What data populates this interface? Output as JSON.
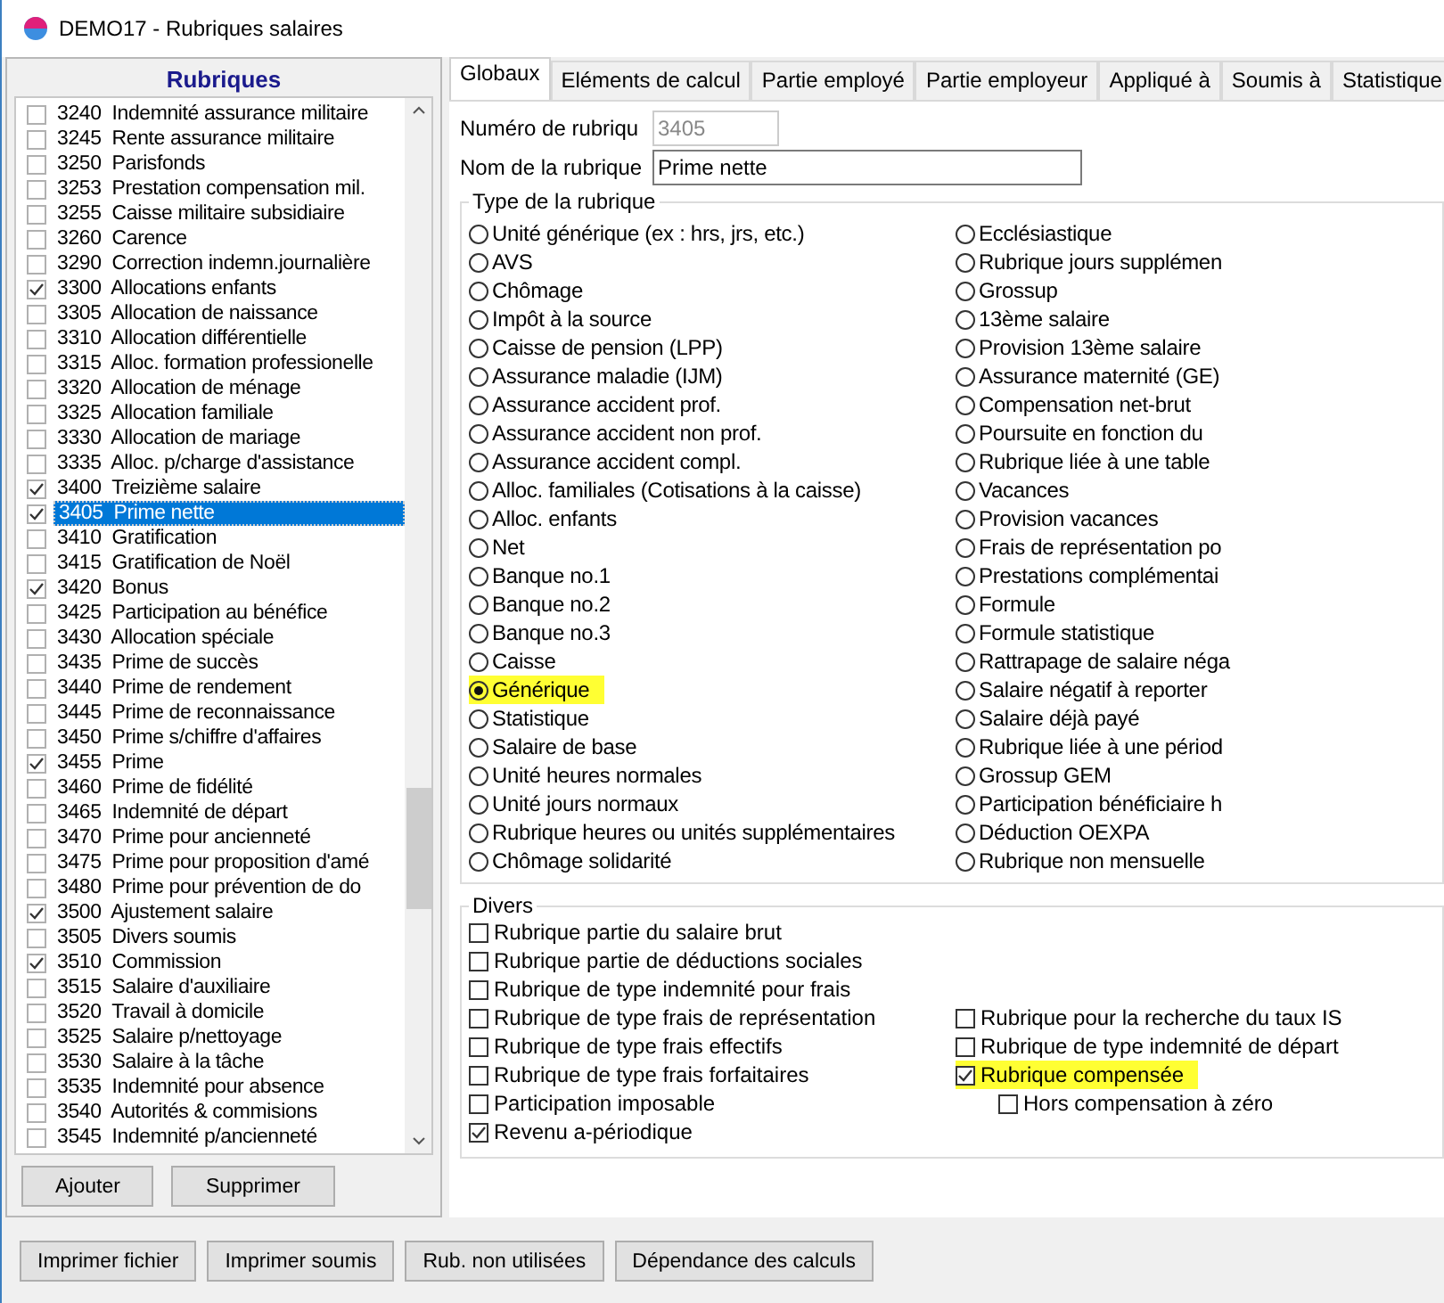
{
  "window": {
    "title": "DEMO17 - Rubriques salaires"
  },
  "sidebar": {
    "title": "Rubriques",
    "items": [
      {
        "code": "3240",
        "name": "Indemnité assurance militaire",
        "checked": false,
        "selected": false
      },
      {
        "code": "3245",
        "name": "Rente assurance militaire",
        "checked": false,
        "selected": false
      },
      {
        "code": "3250",
        "name": "Parisfonds",
        "checked": false,
        "selected": false
      },
      {
        "code": "3253",
        "name": "Prestation compensation mil.",
        "checked": false,
        "selected": false
      },
      {
        "code": "3255",
        "name": "Caisse militaire subsidiaire",
        "checked": false,
        "selected": false
      },
      {
        "code": "3260",
        "name": "Carence",
        "checked": false,
        "selected": false
      },
      {
        "code": "3290",
        "name": "Correction indemn.journalière",
        "checked": false,
        "selected": false
      },
      {
        "code": "3300",
        "name": "Allocations enfants",
        "checked": true,
        "selected": false
      },
      {
        "code": "3305",
        "name": "Allocation de naissance",
        "checked": false,
        "selected": false
      },
      {
        "code": "3310",
        "name": "Allocation différentielle",
        "checked": false,
        "selected": false
      },
      {
        "code": "3315",
        "name": "Alloc. formation professionelle",
        "checked": false,
        "selected": false
      },
      {
        "code": "3320",
        "name": "Allocation de ménage",
        "checked": false,
        "selected": false
      },
      {
        "code": "3325",
        "name": "Allocation familiale",
        "checked": false,
        "selected": false
      },
      {
        "code": "3330",
        "name": "Allocation de mariage",
        "checked": false,
        "selected": false
      },
      {
        "code": "3335",
        "name": "Alloc. p/charge d'assistance",
        "checked": false,
        "selected": false
      },
      {
        "code": "3400",
        "name": "Treizième salaire",
        "checked": true,
        "selected": false
      },
      {
        "code": "3405",
        "name": "Prime nette",
        "checked": true,
        "selected": true
      },
      {
        "code": "3410",
        "name": "Gratification",
        "checked": false,
        "selected": false
      },
      {
        "code": "3415",
        "name": "Gratification de Noël",
        "checked": false,
        "selected": false
      },
      {
        "code": "3420",
        "name": "Bonus",
        "checked": true,
        "selected": false
      },
      {
        "code": "3425",
        "name": "Participation au bénéfice",
        "checked": false,
        "selected": false
      },
      {
        "code": "3430",
        "name": "Allocation spéciale",
        "checked": false,
        "selected": false
      },
      {
        "code": "3435",
        "name": "Prime de succès",
        "checked": false,
        "selected": false
      },
      {
        "code": "3440",
        "name": "Prime de rendement",
        "checked": false,
        "selected": false
      },
      {
        "code": "3445",
        "name": "Prime de reconnaissance",
        "checked": false,
        "selected": false
      },
      {
        "code": "3450",
        "name": "Prime s/chiffre d'affaires",
        "checked": false,
        "selected": false
      },
      {
        "code": "3455",
        "name": "Prime",
        "checked": true,
        "selected": false
      },
      {
        "code": "3460",
        "name": "Prime de fidélité",
        "checked": false,
        "selected": false
      },
      {
        "code": "3465",
        "name": "Indemnité de départ",
        "checked": false,
        "selected": false
      },
      {
        "code": "3470",
        "name": "Prime pour ancienneté",
        "checked": false,
        "selected": false
      },
      {
        "code": "3475",
        "name": "Prime pour proposition d'amé",
        "checked": false,
        "selected": false
      },
      {
        "code": "3480",
        "name": "Prime pour prévention de do",
        "checked": false,
        "selected": false
      },
      {
        "code": "3500",
        "name": "Ajustement salaire",
        "checked": true,
        "selected": false
      },
      {
        "code": "3505",
        "name": "Divers soumis",
        "checked": false,
        "selected": false
      },
      {
        "code": "3510",
        "name": "Commission",
        "checked": true,
        "selected": false
      },
      {
        "code": "3515",
        "name": "Salaire d'auxiliaire",
        "checked": false,
        "selected": false
      },
      {
        "code": "3520",
        "name": "Travail à domicile",
        "checked": false,
        "selected": false
      },
      {
        "code": "3525",
        "name": "Salaire p/nettoyage",
        "checked": false,
        "selected": false
      },
      {
        "code": "3530",
        "name": "Salaire à la tâche",
        "checked": false,
        "selected": false
      },
      {
        "code": "3535",
        "name": "Indemnité pour absence",
        "checked": false,
        "selected": false
      },
      {
        "code": "3540",
        "name": "Autorités & commisions",
        "checked": false,
        "selected": false
      },
      {
        "code": "3545",
        "name": "Indemnité p/ancienneté",
        "checked": false,
        "selected": false
      }
    ],
    "buttons": [
      "Ajouter",
      "Supprimer"
    ]
  },
  "tabs": [
    {
      "label": "Globaux",
      "selected": true
    },
    {
      "label": "Eléments de calcul",
      "selected": false
    },
    {
      "label": "Partie employé",
      "selected": false
    },
    {
      "label": "Partie employeur",
      "selected": false
    },
    {
      "label": "Appliqué à",
      "selected": false
    },
    {
      "label": "Soumis à",
      "selected": false
    },
    {
      "label": "Statistique",
      "selected": false
    }
  ],
  "fields": [
    {
      "label": "Numéro de rubriqu",
      "value": "3405",
      "disabled": true
    },
    {
      "label": "Nom de la rubrique",
      "value": "Prime nette",
      "disabled": false
    }
  ],
  "type_group": {
    "title": "Type de la rubrique",
    "columns": [
      [
        {
          "label": "Unité générique (ex : hrs, jrs, etc.)",
          "selected": false,
          "highlighted": false
        },
        {
          "label": "AVS",
          "selected": false,
          "highlighted": false
        },
        {
          "label": "Chômage",
          "selected": false,
          "highlighted": false
        },
        {
          "label": "Impôt à la source",
          "selected": false,
          "highlighted": false
        },
        {
          "label": "Caisse de pension (LPP)",
          "selected": false,
          "highlighted": false
        },
        {
          "label": "Assurance maladie (IJM)",
          "selected": false,
          "highlighted": false
        },
        {
          "label": "Assurance accident prof.",
          "selected": false,
          "highlighted": false
        },
        {
          "label": "Assurance accident non prof.",
          "selected": false,
          "highlighted": false
        },
        {
          "label": "Assurance accident compl.",
          "selected": false,
          "highlighted": false
        },
        {
          "label": "Alloc. familiales (Cotisations à la caisse)",
          "selected": false,
          "highlighted": false
        },
        {
          "label": "Alloc. enfants",
          "selected": false,
          "highlighted": false
        },
        {
          "label": "Net",
          "selected": false,
          "highlighted": false
        },
        {
          "label": "Banque no.1",
          "selected": false,
          "highlighted": false
        },
        {
          "label": "Banque no.2",
          "selected": false,
          "highlighted": false
        },
        {
          "label": "Banque no.3",
          "selected": false,
          "highlighted": false
        },
        {
          "label": "Caisse",
          "selected": false,
          "highlighted": false
        },
        {
          "label": "Générique",
          "selected": true,
          "highlighted": true
        },
        {
          "label": "Statistique",
          "selected": false,
          "highlighted": false
        },
        {
          "label": "Salaire de base",
          "selected": false,
          "highlighted": false
        },
        {
          "label": "Unité heures normales",
          "selected": false,
          "highlighted": false
        },
        {
          "label": "Unité jours normaux",
          "selected": false,
          "highlighted": false
        },
        {
          "label": "Rubrique heures ou unités supplémentaires",
          "selected": false,
          "highlighted": false
        },
        {
          "label": "Chômage solidarité",
          "selected": false,
          "highlighted": false
        }
      ],
      [
        {
          "label": "Ecclésiastique",
          "selected": false,
          "highlighted": false
        },
        {
          "label": "Rubrique jours supplémen",
          "selected": false,
          "highlighted": false
        },
        {
          "label": "Grossup",
          "selected": false,
          "highlighted": false
        },
        {
          "label": "13ème salaire",
          "selected": false,
          "highlighted": false
        },
        {
          "label": "Provision 13ème salaire",
          "selected": false,
          "highlighted": false
        },
        {
          "label": "Assurance maternité (GE)",
          "selected": false,
          "highlighted": false
        },
        {
          "label": "Compensation net-brut",
          "selected": false,
          "highlighted": false
        },
        {
          "label": "Poursuite en fonction du",
          "selected": false,
          "highlighted": false
        },
        {
          "label": "Rubrique liée à une table",
          "selected": false,
          "highlighted": false
        },
        {
          "label": "Vacances",
          "selected": false,
          "highlighted": false
        },
        {
          "label": "Provision vacances",
          "selected": false,
          "highlighted": false
        },
        {
          "label": "Frais de représentation po",
          "selected": false,
          "highlighted": false
        },
        {
          "label": "Prestations complémentai",
          "selected": false,
          "highlighted": false
        },
        {
          "label": "Formule",
          "selected": false,
          "highlighted": false
        },
        {
          "label": "Formule statistique",
          "selected": false,
          "highlighted": false
        },
        {
          "label": "Rattrapage de salaire néga",
          "selected": false,
          "highlighted": false
        },
        {
          "label": "Salaire négatif à reporter",
          "selected": false,
          "highlighted": false
        },
        {
          "label": "Salaire déjà payé",
          "selected": false,
          "highlighted": false
        },
        {
          "label": "Rubrique liée à une périod",
          "selected": false,
          "highlighted": false
        },
        {
          "label": "Grossup GEM",
          "selected": false,
          "highlighted": false
        },
        {
          "label": "Participation bénéficiaire h",
          "selected": false,
          "highlighted": false
        },
        {
          "label": "Déduction OEXPA",
          "selected": false,
          "highlighted": false
        },
        {
          "label": "Rubrique non mensuelle",
          "selected": false,
          "highlighted": false
        }
      ]
    ]
  },
  "divers": {
    "title": "Divers",
    "columns": [
      [
        {
          "label": "Rubrique partie du salaire brut",
          "checked": false,
          "highlighted": false
        },
        {
          "label": "Rubrique partie de déductions sociales",
          "checked": false,
          "highlighted": false
        },
        {
          "label": "Rubrique de type indemnité pour frais",
          "checked": false,
          "highlighted": false
        },
        {
          "label": "Rubrique de type frais de représentation",
          "checked": false,
          "highlighted": false
        },
        {
          "label": "Rubrique de type frais effectifs",
          "checked": false,
          "highlighted": false
        },
        {
          "label": "Rubrique de type frais forfaitaires",
          "checked": false,
          "highlighted": false
        },
        {
          "label": "Participation imposable",
          "checked": false,
          "highlighted": false
        },
        {
          "label": "Revenu a-périodique",
          "checked": true,
          "highlighted": false
        }
      ],
      [
        {
          "label": "Rubrique pour la recherche du taux IS",
          "checked": false,
          "highlighted": false
        },
        {
          "label": "Rubrique de type indemnité de départ",
          "checked": false,
          "highlighted": false
        },
        {
          "label": "Rubrique compensée",
          "checked": true,
          "highlighted": true,
          "children": [
            {
              "label": "Hors compensation à zéro",
              "checked": false,
              "highlighted": false
            }
          ]
        }
      ]
    ]
  },
  "bottom_buttons": [
    "Imprimer fichier",
    "Imprimer soumis",
    "Rub. non utilisées",
    "Dépendance des calculs"
  ]
}
